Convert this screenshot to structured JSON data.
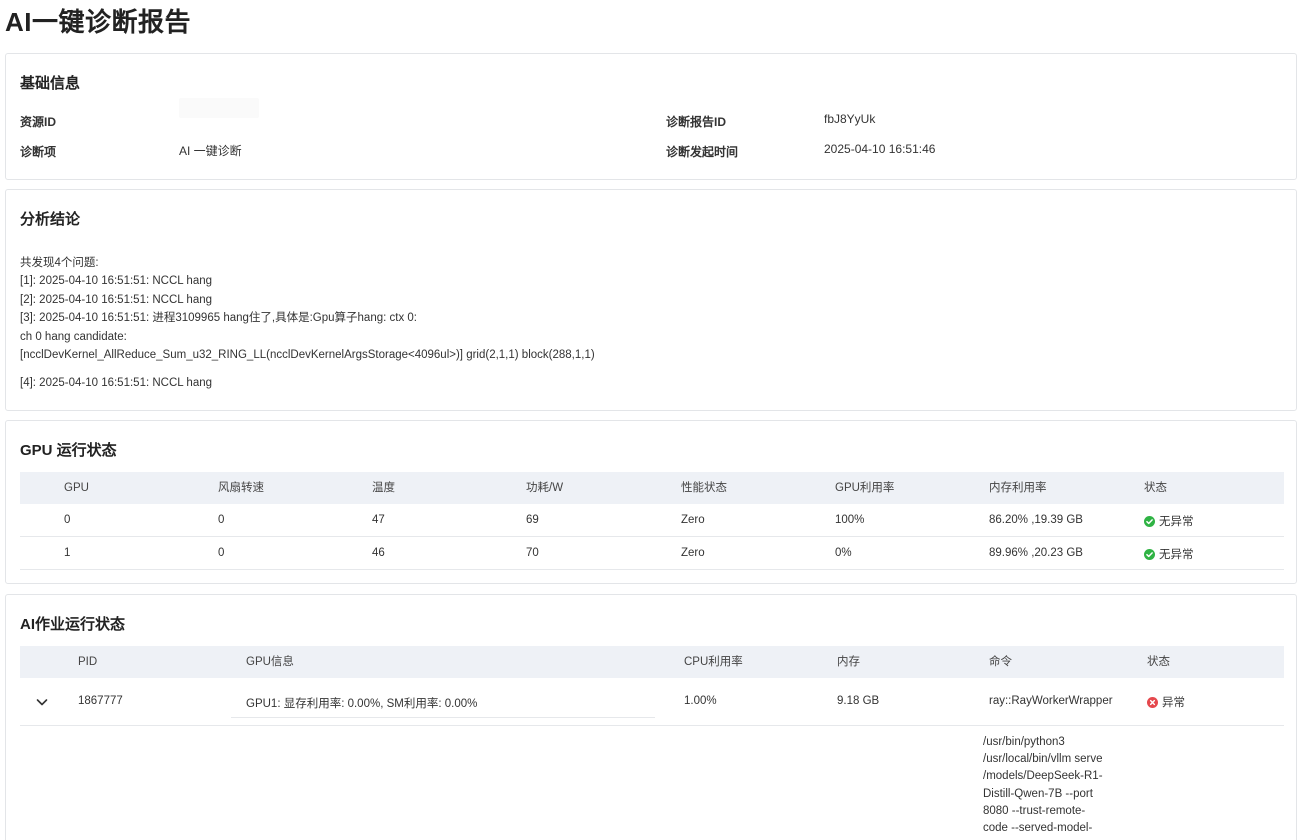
{
  "page_title": "AI一键诊断报告",
  "basic": {
    "title": "基础信息",
    "resource_id_label": "资源ID",
    "resource_id_value": "",
    "report_id_label": "诊断报告ID",
    "report_id_value": "fbJ8YyUk",
    "item_label": "诊断项",
    "item_value": "AI 一键诊断",
    "time_label": "诊断发起时间",
    "time_value": "2025-04-10 16:51:46"
  },
  "analysis": {
    "title": "分析结论",
    "lines": [
      "共发现4个问题:",
      "[1]: 2025-04-10 16:51:51: NCCL hang",
      "[2]: 2025-04-10 16:51:51: NCCL hang",
      "[3]: 2025-04-10 16:51:51: 进程3109965 hang住了,具体是:Gpu算子hang: ctx 0:",
      "ch 0 hang candidate:",
      "[ncclDevKernel_AllReduce_Sum_u32_RING_LL(ncclDevKernelArgsStorage<4096ul>)] grid(2,1,1) block(288,1,1)",
      "[4]: 2025-04-10 16:51:51: NCCL hang"
    ]
  },
  "gpu_status": {
    "title": "GPU 运行状态",
    "columns": [
      "GPU",
      "风扇转速",
      "温度",
      "功耗/W",
      "性能状态",
      "GPU利用率",
      "内存利用率",
      "状态"
    ],
    "rows": [
      [
        "0",
        "0",
        "47",
        "69",
        "Zero",
        "100%",
        "86.20% ,19.39 GB",
        "无异常"
      ],
      [
        "1",
        "0",
        "46",
        "70",
        "Zero",
        "0%",
        "89.96% ,20.23 GB",
        "无异常"
      ]
    ],
    "ok_color": "#2fb344"
  },
  "job_status": {
    "title": "AI作业运行状态",
    "columns": [
      "PID",
      "GPU信息",
      "CPU利用率",
      "内存",
      "命令",
      "状态"
    ],
    "row": {
      "pid": "1867777",
      "gpu_info": "GPU1: 显存利用率: 0.00%,  SM利用率: 0.00%",
      "cpu": "1.00%",
      "mem": "9.18 GB",
      "cmd": "ray::RayWorkerWrapper",
      "status": "异常"
    },
    "expanded_cmd_lines": [
      "/usr/bin/python3",
      "/usr/local/bin/vllm serve",
      "/models/DeepSeek-R1-",
      "Distill-Qwen-7B --port",
      "8080 --trust-remote-",
      "code --served-model-"
    ],
    "error_color": "#e5484d"
  },
  "icons": {
    "ok": "check-circle-icon",
    "error": "close-circle-icon",
    "expand": "chevron-down-icon"
  }
}
